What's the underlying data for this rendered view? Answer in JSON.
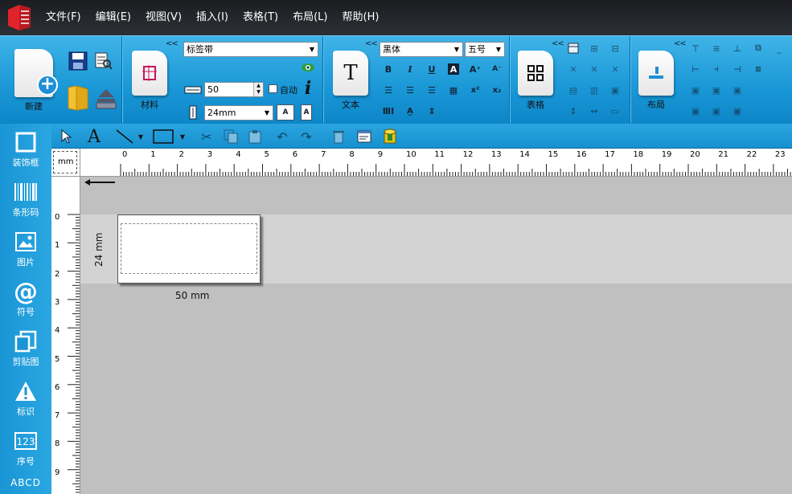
{
  "menu": [
    "文件(F)",
    "编辑(E)",
    "视图(V)",
    "插入(I)",
    "表格(T)",
    "布局(L)",
    "帮助(H)"
  ],
  "ribbon": {
    "collapse": "<<",
    "new_label": "新建",
    "material_label": "材料",
    "label_type_value": "标签带",
    "width_value": "50",
    "auto_label": "自动",
    "height_value": "24mm",
    "text_label": "文本",
    "font_value": "黑体",
    "font_size_value": "五号",
    "table_label": "表格",
    "layout_label": "布局",
    "bold": "B",
    "italic": "I",
    "underline": "U"
  },
  "left_tools": [
    "装饰框",
    "条形码",
    "图片",
    "符号",
    "剪贴图",
    "标识",
    "序号"
  ],
  "left_tools_partial": "ABCD",
  "ruler": {
    "unit": "mm",
    "h_ticks": [
      "0",
      "1",
      "2",
      "3",
      "4",
      "5",
      "6",
      "7",
      "8",
      "9",
      "10",
      "11",
      "12",
      "13",
      "14",
      "15",
      "16",
      "17",
      "18",
      "19",
      "20",
      "21",
      "22",
      "23"
    ],
    "v_ticks": [
      "0",
      "1",
      "2",
      "3",
      "4",
      "5",
      "6",
      "7",
      "8",
      "9"
    ]
  },
  "canvas": {
    "width_label": "50 mm",
    "height_label": "24 mm"
  },
  "colors": {
    "ribbon": "#1a97d6",
    "menubar": "#1b1d20",
    "canvas": "#c0c0c0"
  }
}
